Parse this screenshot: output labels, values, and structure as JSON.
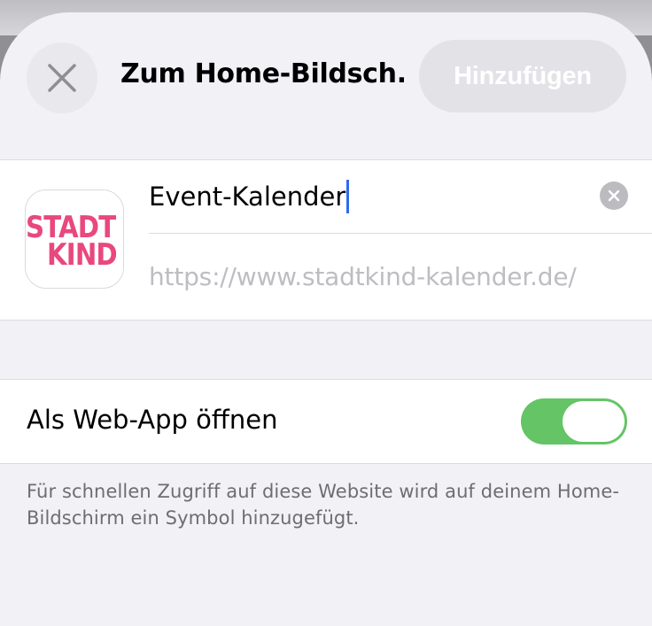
{
  "header": {
    "title": "Zum Home-Bildsch...",
    "add_label": "Hinzufügen",
    "close_icon": "close-icon"
  },
  "form": {
    "icon_logo_line1": "STADT",
    "icon_logo_line2": "KIND",
    "name_value": "Event-Kalender",
    "url_value": "https://www.stadtkind-kalender.de/",
    "clear_icon": "clear-icon"
  },
  "web_app": {
    "label": "Als Web-App öffnen",
    "enabled": true
  },
  "footnote": "Für schnellen Zugriff auf diese Website wird auf deinem Home-Bildschirm ein Symbol hinzugefügt.",
  "colors": {
    "logo": "#e8487e",
    "switch_on": "#65c466",
    "caret": "#2f6bf0"
  }
}
